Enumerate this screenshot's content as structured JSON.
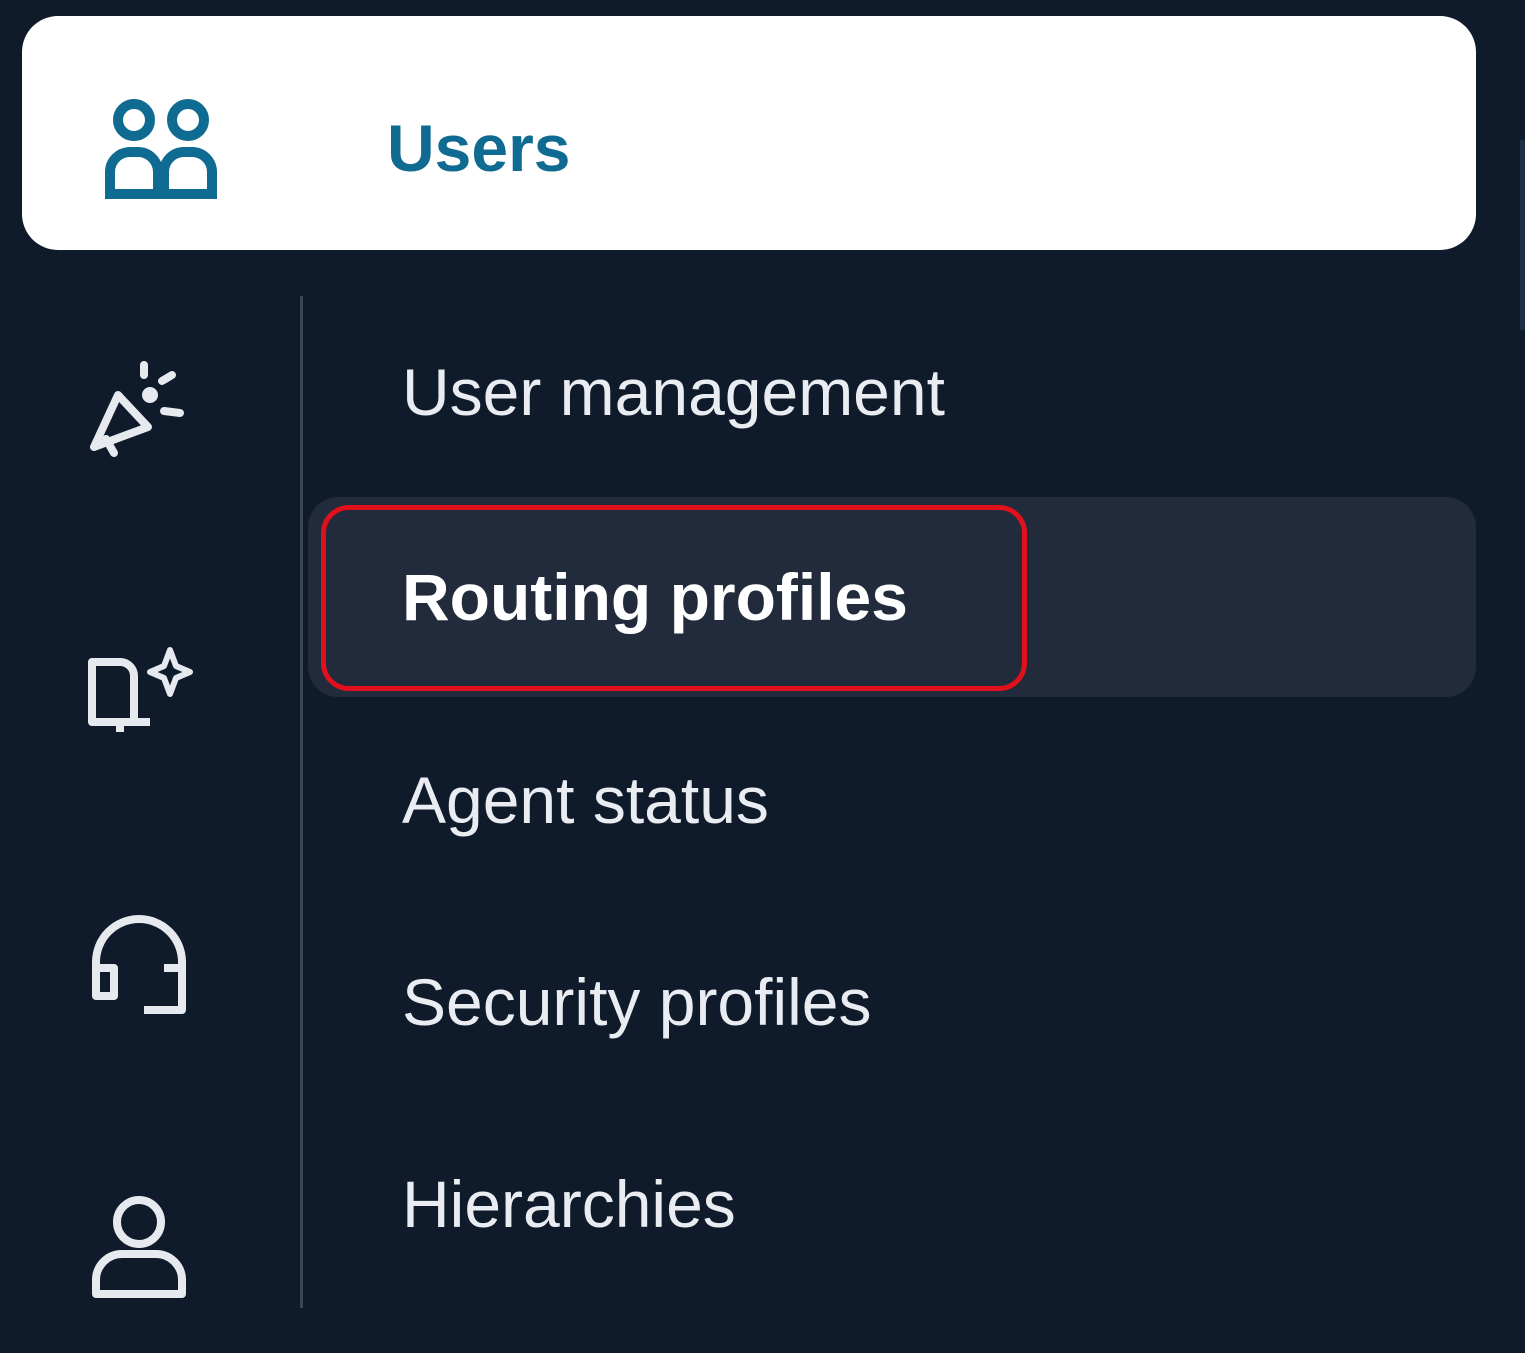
{
  "header": {
    "title": "Users",
    "icon": "users-group-icon",
    "accent_color": "#0f6b91"
  },
  "rail_icons": [
    "campaign-icon",
    "knowledge-book-icon",
    "headset-icon",
    "user-icon"
  ],
  "menu": {
    "items": [
      {
        "label": "User management",
        "active": false
      },
      {
        "label": "Routing profiles",
        "active": true
      },
      {
        "label": "Agent status",
        "active": false
      },
      {
        "label": "Security profiles",
        "active": false
      },
      {
        "label": "Hierarchies",
        "active": false
      }
    ]
  },
  "colors": {
    "background": "#0f1a2a",
    "active_item_bg": "#212b3b",
    "highlight_outline": "#e0101c",
    "text": "#e9edf2"
  }
}
